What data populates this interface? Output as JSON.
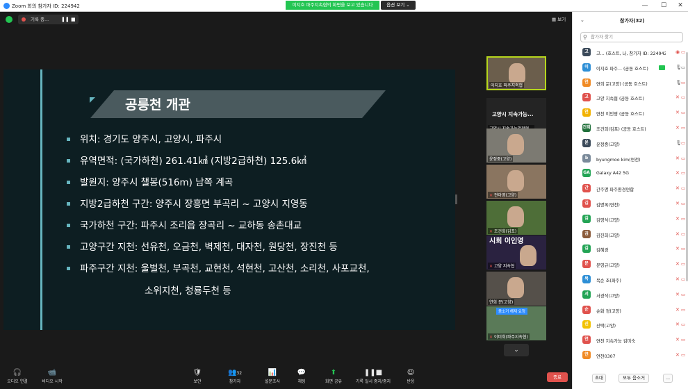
{
  "window": {
    "title": "Zoom 회의 참가자 ID: 224942",
    "share_banner": "이지호 파주지속협의 화면을 보고 있습니다",
    "view_options": "옵션 보기 ⌄",
    "controls": [
      "—",
      "☐",
      "✕"
    ]
  },
  "topbar": {
    "recording_label": "기록 중...",
    "pause": "❚❚",
    "stop": "■",
    "view_button": "▦ 보기"
  },
  "slide": {
    "title": "공릉천 개관",
    "bullets": [
      "위치: 경기도 양주시, 고양시, 파주시",
      "유역면적: (국가하천) 261.41㎢ (지방2급하천) 125.6㎢",
      "발원지: 양주시 챌봉(516m) 남쪽 계곡",
      "지방2급하천 구간: 양주시 장흥면 부곡리 ~ 고양시 지영동",
      "국가하천 구간: 파주시 조리읍 장곡리 ~ 교하동 송촌대교",
      "고양구간 지천: 선유천, 오금천, 벽제천, 대자천, 원당천, 장진천 등",
      "파주구간 지천: 울벌천, 부곡천, 교현천, 석현천, 고산천, 소리천, 사포교천,"
    ],
    "continuation": "소위지천, 청룡두천 등"
  },
  "thumbnails": [
    {
      "name": "이지호 파주지속협",
      "muted": false,
      "active": true
    },
    {
      "name": "고양시 지속가능...",
      "sub": "고양시 지속가능발전협...",
      "type": "text"
    },
    {
      "name": "윤정중(고양)",
      "muted": false
    },
    {
      "name": "전아영(고양)",
      "muted": true
    },
    {
      "name": "조건희(김포)",
      "muted": true
    },
    {
      "name": "고양 지속협",
      "muted": true,
      "sign": "시회 이인영"
    },
    {
      "name": "연희 문(고양)",
      "muted": false
    },
    {
      "name": "이미희(파주지속협)",
      "muted": true,
      "caption": "음소거 해제 요청"
    }
  ],
  "toolbar": {
    "items": [
      {
        "label": "오디오 연결",
        "icon": "🎧"
      },
      {
        "label": "비디오 시작",
        "icon": "📹"
      },
      {
        "label": "보안",
        "icon": "🛡"
      },
      {
        "label": "참가자",
        "icon": "👥",
        "count": "32"
      },
      {
        "label": "설문조사",
        "icon": "📊"
      },
      {
        "label": "채팅",
        "icon": "💬"
      },
      {
        "label": "화면 공유",
        "icon": "⬆"
      },
      {
        "label": "기록 일시 중지/중지",
        "icon": "❚❚■"
      },
      {
        "label": "반응",
        "icon": "☺"
      }
    ],
    "end_label": "종료"
  },
  "panel": {
    "title": "참가자(32)",
    "search_placeholder": "참가자 찾기",
    "participants": [
      {
        "name": "고... (호스트, 나, 참가자 ID: 224942)",
        "avatar": "고",
        "color": "#3b4a5a",
        "mic": "rec",
        "cam": "off"
      },
      {
        "name": "이지호 파주... (공동 호스트)",
        "avatar": "이",
        "color": "#2e8fd6",
        "mic": "on",
        "cam": "on",
        "video": true
      },
      {
        "name": "연희 문(고양) (공동 호스트)",
        "avatar": "연",
        "color": "#f08a24",
        "mic": "on",
        "cam": "off"
      },
      {
        "name": "고양 지속협 (공동 호스트)",
        "avatar": "고",
        "color": "#e0524d",
        "mic": "off",
        "cam": "off"
      },
      {
        "name": "연천 이인영 (공동 호스트)",
        "avatar": "연",
        "color": "#f2b200",
        "mic": "off",
        "cam": "off"
      },
      {
        "name": "조건희(김포) (공동 호스트)",
        "avatar": "건희",
        "color": "#1f6f3a",
        "mic": "off",
        "cam": "off"
      },
      {
        "name": "윤정중(고양)",
        "avatar": "윤",
        "color": "#3b4a5a",
        "mic": "on",
        "cam": "off"
      },
      {
        "name": "byungmoo kim(연천)",
        "avatar": "b",
        "color": "#7a8a9a",
        "mic": "off",
        "cam": "off"
      },
      {
        "name": "Galaxy A42 5G",
        "avatar": "GA",
        "color": "#23a455",
        "mic": "off",
        "cam": "off"
      },
      {
        "name": "간주명 파주환경연합",
        "avatar": "간",
        "color": "#e0524d",
        "mic": "off",
        "cam": "off"
      },
      {
        "name": "김명록(연천)",
        "avatar": "김",
        "color": "#e0524d",
        "mic": "off",
        "cam": "off"
      },
      {
        "name": "김영식(고양)",
        "avatar": "김",
        "color": "#23a455",
        "mic": "off",
        "cam": "off"
      },
      {
        "name": "김진희(고양)",
        "avatar": "김",
        "color": "#8a5a3a",
        "mic": "off",
        "cam": "off"
      },
      {
        "name": "김혜경",
        "avatar": "김",
        "color": "#23a455",
        "mic": "off",
        "cam": "off"
      },
      {
        "name": "문영규(고양)",
        "avatar": "문",
        "color": "#e0524d",
        "mic": "off",
        "cam": "off"
      },
      {
        "name": "복순 조(파주)",
        "avatar": "복",
        "color": "#2e8fd6",
        "mic": "off",
        "cam": "off"
      },
      {
        "name": "서경석(고양)",
        "avatar": "서",
        "color": "#23a455",
        "mic": "off",
        "cam": "off"
      },
      {
        "name": "순화 정(고양)",
        "avatar": "순",
        "color": "#e0524d",
        "mic": "off",
        "cam": "off"
      },
      {
        "name": "신택(고양)",
        "avatar": "신",
        "color": "#f2c200",
        "mic": "off",
        "cam": "off"
      },
      {
        "name": "연천 지속가능 김미숙",
        "avatar": "연",
        "color": "#e0524d",
        "mic": "off",
        "cam": "off"
      },
      {
        "name": "연천0307",
        "avatar": "연",
        "color": "#f08a24",
        "mic": "off",
        "cam": "off"
      }
    ],
    "footer": {
      "invite": "초대",
      "mute_all": "모두 음소거",
      "more": "..."
    }
  }
}
